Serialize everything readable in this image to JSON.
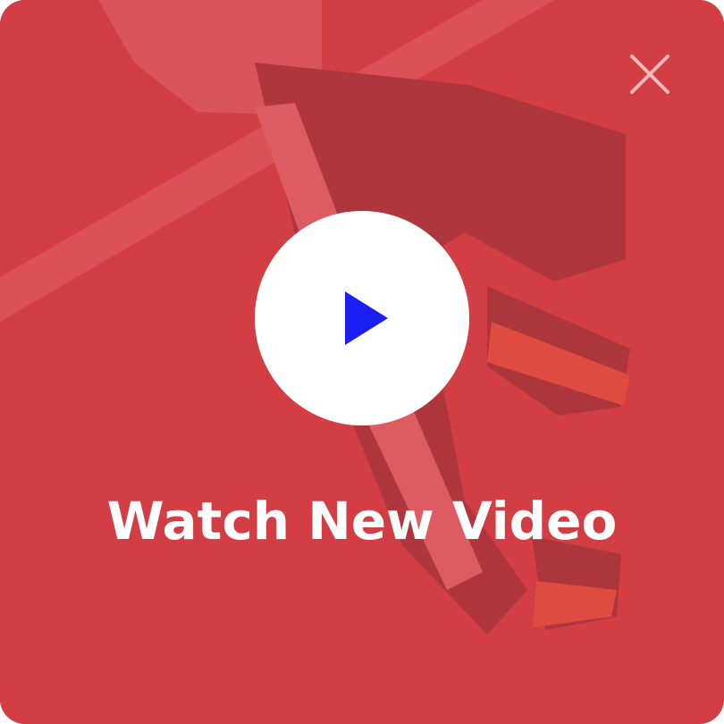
{
  "promo": {
    "title": "Watch New Video",
    "overlay_color": "#d44246",
    "play_button_color": "#ffffff",
    "play_icon_color": "#1a1ff2",
    "close_icon_color": "#f7b9bb"
  },
  "icons": {
    "close": "close-icon",
    "play": "play-icon"
  }
}
